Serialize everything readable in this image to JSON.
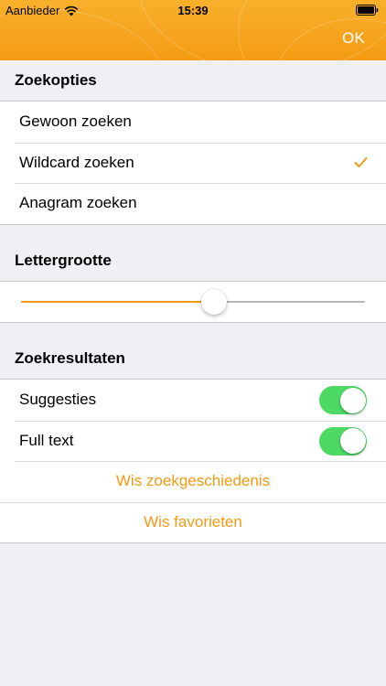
{
  "status_bar": {
    "carrier": "Aanbieder",
    "time": "15:39",
    "wifi_icon": "wifi-icon",
    "battery_icon": "battery-icon"
  },
  "nav": {
    "ok_label": "OK",
    "accent_color": "#f6a51f"
  },
  "search_options": {
    "header": "Zoekopties",
    "items": [
      {
        "label": "Gewoon zoeken",
        "selected": false
      },
      {
        "label": "Wildcard zoeken",
        "selected": true
      },
      {
        "label": "Anagram zoeken",
        "selected": false
      }
    ],
    "check_color": "#f39a14"
  },
  "font_size": {
    "header": "Lettergrootte",
    "slider_value": 0.56
  },
  "results": {
    "header": "Zoekresultaten",
    "toggles": [
      {
        "label": "Suggesties",
        "on": true
      },
      {
        "label": "Full text",
        "on": true
      }
    ],
    "actions": [
      {
        "label": "Wis zoekgeschiedenis"
      },
      {
        "label": "Wis favorieten"
      }
    ],
    "toggle_color": "#4cd964",
    "action_color": "#f39a14"
  }
}
